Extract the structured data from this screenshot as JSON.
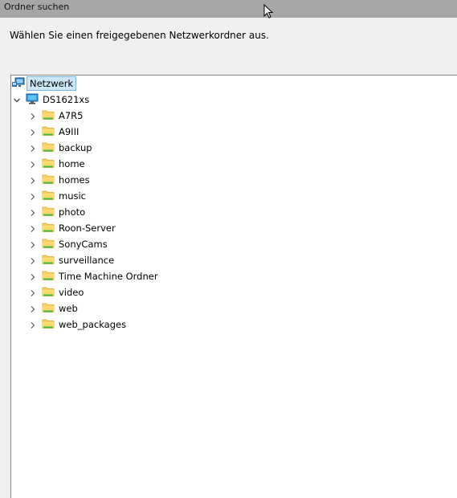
{
  "window": {
    "title": "Ordner suchen"
  },
  "instruction": "Wählen Sie einen freigegebenen Netzwerkordner aus.",
  "tree": {
    "root": {
      "label": "Netzwerk",
      "icon": "network-icon",
      "selected": true
    },
    "host": {
      "label": "DS1621xs",
      "icon": "computer-icon",
      "expanded": true
    },
    "folders": [
      "A7R5",
      "A9III",
      "backup",
      "home",
      "homes",
      "music",
      "photo",
      "Roon-Server",
      "SonyCams",
      "surveillance",
      "Time Machine Ordner",
      "video",
      "web",
      "web_packages"
    ]
  },
  "colors": {
    "titlebar": "#a6a6a6",
    "dialog_bg": "#f0f0f0",
    "tree_bg": "#ffffff",
    "selection_bg": "#cce6fa",
    "selection_border": "#7ab4e0",
    "folder_yellow": "#f6d365",
    "folder_green": "#3fbf3f"
  }
}
